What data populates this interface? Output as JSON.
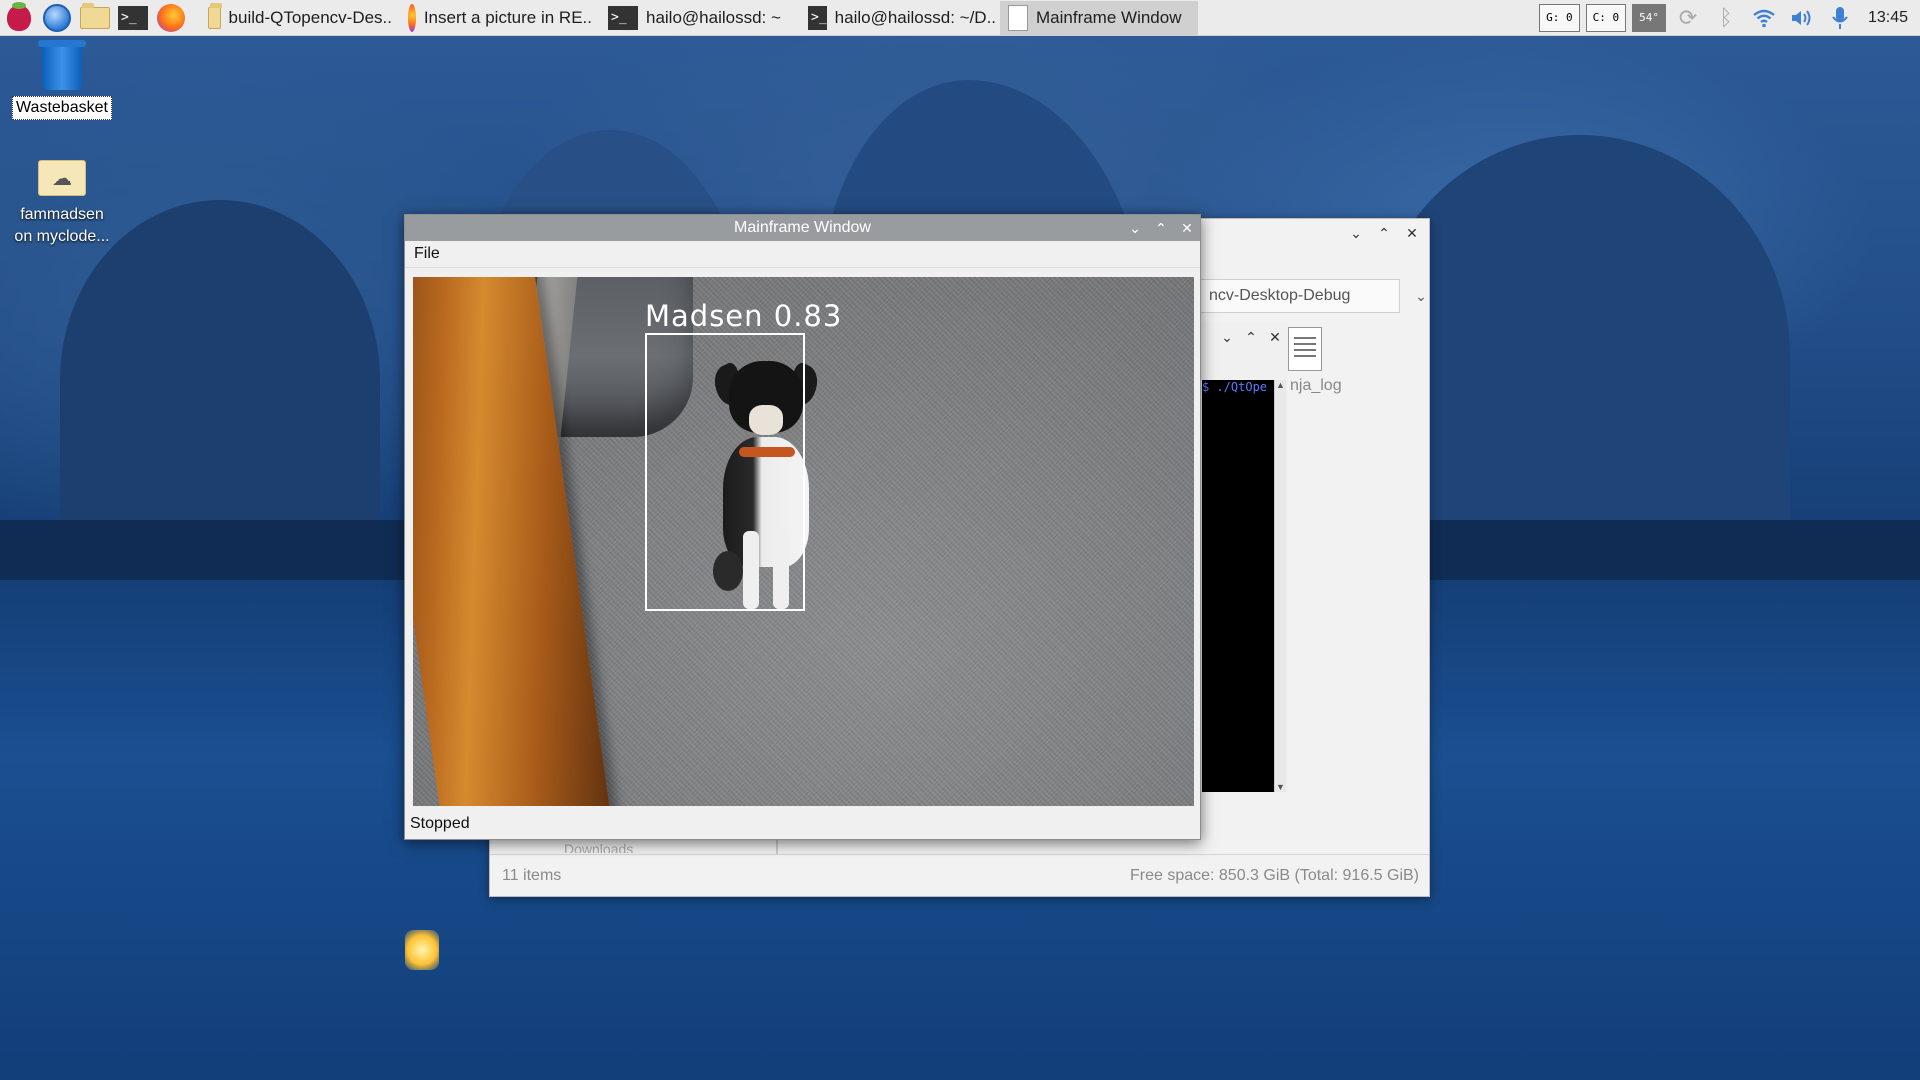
{
  "taskbar": {
    "launchers": [
      "raspberry-menu-icon",
      "web-browser-icon",
      "file-manager-icon",
      "terminal-icon",
      "firefox-icon"
    ],
    "tasks": [
      {
        "label": "build-QTopencv-Des..",
        "icon": "folder-icon",
        "active": false
      },
      {
        "label": "Insert a picture in RE..",
        "icon": "firefox-icon",
        "active": false
      },
      {
        "label": "hailo@hailossd: ~",
        "icon": "terminal-icon",
        "active": false
      },
      {
        "label": "hailo@hailossd: ~/D..",
        "icon": "terminal-icon",
        "active": false
      },
      {
        "label": "Mainframe Window",
        "icon": "document-icon",
        "active": true
      }
    ],
    "monitors": {
      "gpu": "G:  0",
      "cpu": "C:  0",
      "temp": "54°"
    },
    "tray": [
      "sync-icon",
      "bluetooth-icon",
      "wifi-icon",
      "volume-icon",
      "microphone-icon"
    ],
    "clock": "13:45"
  },
  "desktop": {
    "icons": [
      {
        "label": "Wastebasket",
        "icon": "trash-icon"
      },
      {
        "label": "fammadsen\non myclode...",
        "line1": "fammadsen",
        "line2": "on myclode...",
        "icon": "cloud-folder-icon"
      }
    ]
  },
  "file_manager": {
    "path_visible": "ncv-Desktop-Debug",
    "file_label": "nja_log",
    "sidebar_item": "Downloads",
    "status_items": "11 items",
    "status_space": "Free space: 850.3 GiB (Total: 916.5 GiB)"
  },
  "terminal": {
    "command": "$ ./QtOpe"
  },
  "mainframe": {
    "title": "Mainframe Window",
    "menu": [
      "File"
    ],
    "detection": {
      "label": "Madsen",
      "confidence": "0.83",
      "text": "Madsen 0.83",
      "color": "#ffffff"
    },
    "status": "Stopped"
  },
  "colors": {
    "taskbar_bg": "#ebebeb",
    "titlebar_active": "#999c9f",
    "desktop_blue": "#1e4f8a"
  }
}
